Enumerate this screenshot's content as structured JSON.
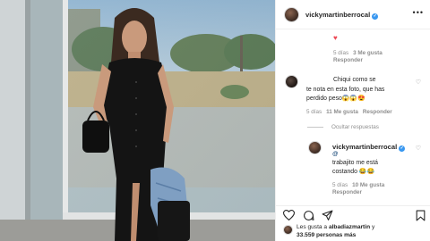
{
  "post": {
    "author": "vickymartinberrocal",
    "verified_icon": "verified-badge-icon",
    "more_icon": "more-options-icon"
  },
  "comments": [
    {
      "id": "top-comment-tail",
      "text": "",
      "emoji": "♥",
      "time": "5 días",
      "likes": "3 Me gusta",
      "reply": "Responder"
    },
    {
      "id": "comment-2",
      "username_hidden": "",
      "text_line1": "Chiqui como se",
      "text_line2": "te nota en esta foto, que has",
      "text_line3": "perdido peso😱😱😍",
      "time": "5 días",
      "likes": "11 Me gusta",
      "reply": "Responder"
    }
  ],
  "hide_replies": "Ocultar respuestas",
  "reply": {
    "username": "vickymartinberrocal",
    "mention": "@",
    "text": "trabajito me está",
    "text2": "costando 😂😂",
    "time": "5 días",
    "likes": "10 Me gusta",
    "reply": "Responder"
  },
  "actions": {
    "like_icon": "heart-icon",
    "comment_icon": "comment-icon",
    "share_icon": "share-icon",
    "save_icon": "bookmark-icon"
  },
  "likes_summary": {
    "prefix": "Les gusta a ",
    "user": "albadiazmartin",
    "connector": " y",
    "count": "33.559 personas más"
  },
  "colors": {
    "verified": "#3897f0",
    "heart": "#ed4956",
    "meta_gray": "#8e8e8e"
  }
}
